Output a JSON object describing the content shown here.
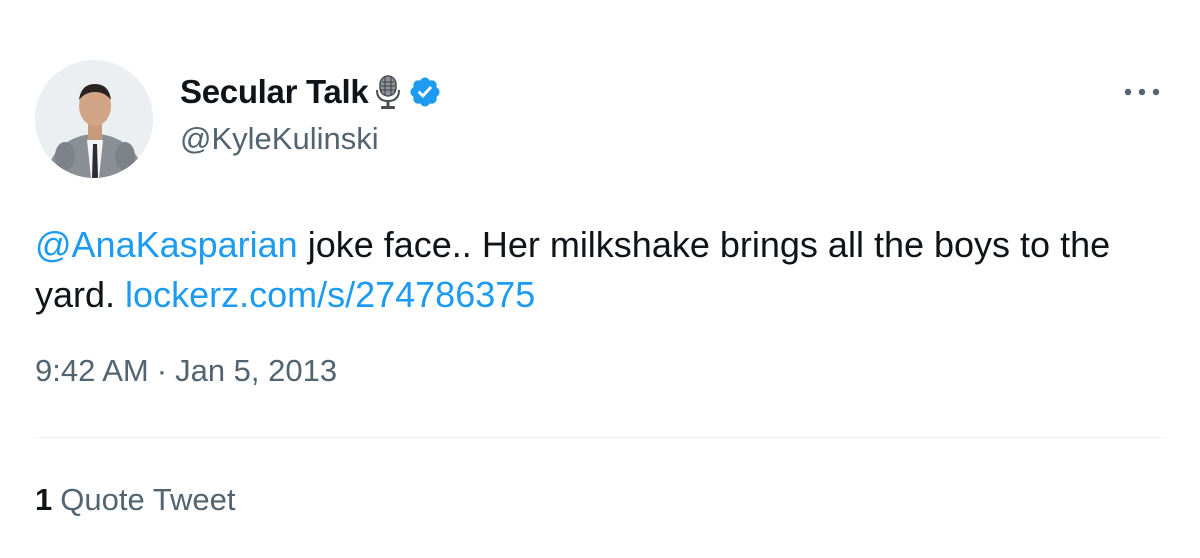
{
  "author": {
    "display_name": "Secular Talk",
    "handle": "@KyleKulinski",
    "avatar_icon": "profile-photo-man-in-suit",
    "name_emoji_icon": "microphone-icon",
    "verified_icon": "verified-badge-icon",
    "verified_color": "#1d9bf0"
  },
  "menu": {
    "more_icon": "more-horizontal-icon"
  },
  "tweet": {
    "mention": "@AnaKasparian",
    "text_part1": " joke face.. Her milkshake brings all the boys to the yard. ",
    "link": "lockerz.com/s/274786375",
    "link_color": "#1d9bf0"
  },
  "meta": {
    "time": "9:42 AM",
    "separator": "·",
    "date": "Jan 5, 2013"
  },
  "stats": {
    "quote_count": "1",
    "quote_label": "Quote Tweet"
  },
  "colors": {
    "primary_text": "#0f1419",
    "secondary_text": "#536471",
    "divider": "#eff3f4"
  }
}
